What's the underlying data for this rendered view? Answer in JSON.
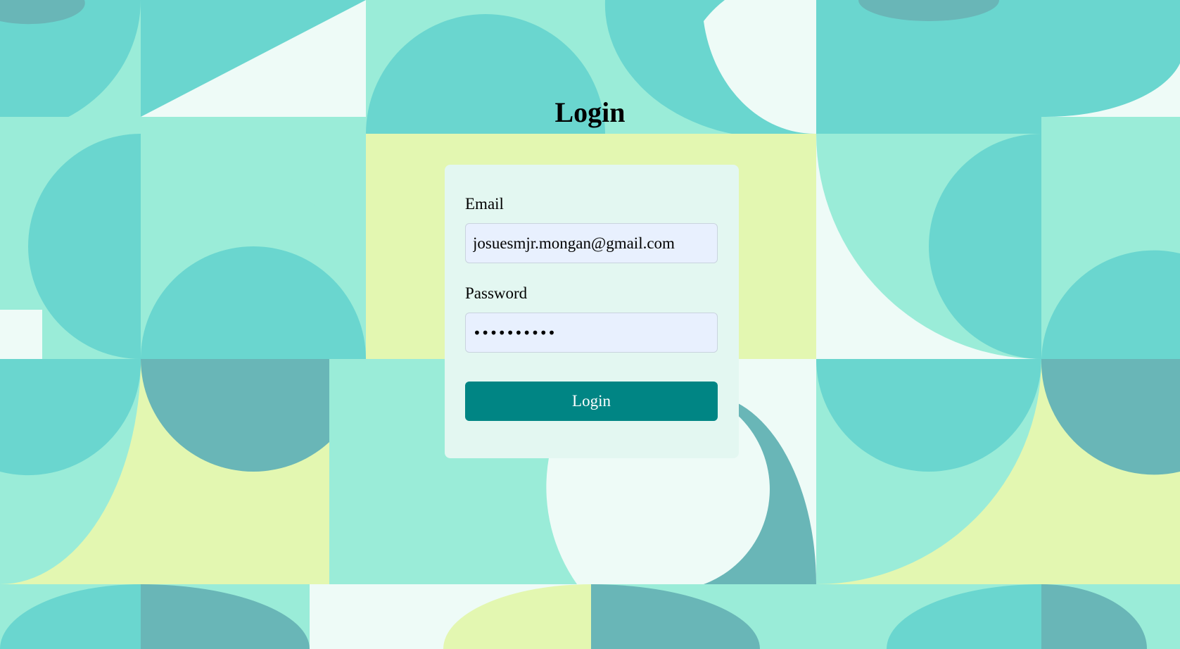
{
  "page": {
    "title": "Login"
  },
  "form": {
    "email_label": "Email",
    "email_value": "josuesmjr.mongan@gmail.com",
    "password_label": "Password",
    "password_value": "••••••••••",
    "submit_label": "Login"
  },
  "theme": {
    "background_light": "#eefbf7",
    "teal_light": "#9aecd8",
    "teal_mid": "#6ad6cf",
    "teal_dark": "#69b6b7",
    "yellow": "#e3f7b1",
    "card_bg": "#e3f7f1",
    "input_bg": "#e8f0fe",
    "button_bg": "#008584",
    "button_text": "#ffffff"
  }
}
